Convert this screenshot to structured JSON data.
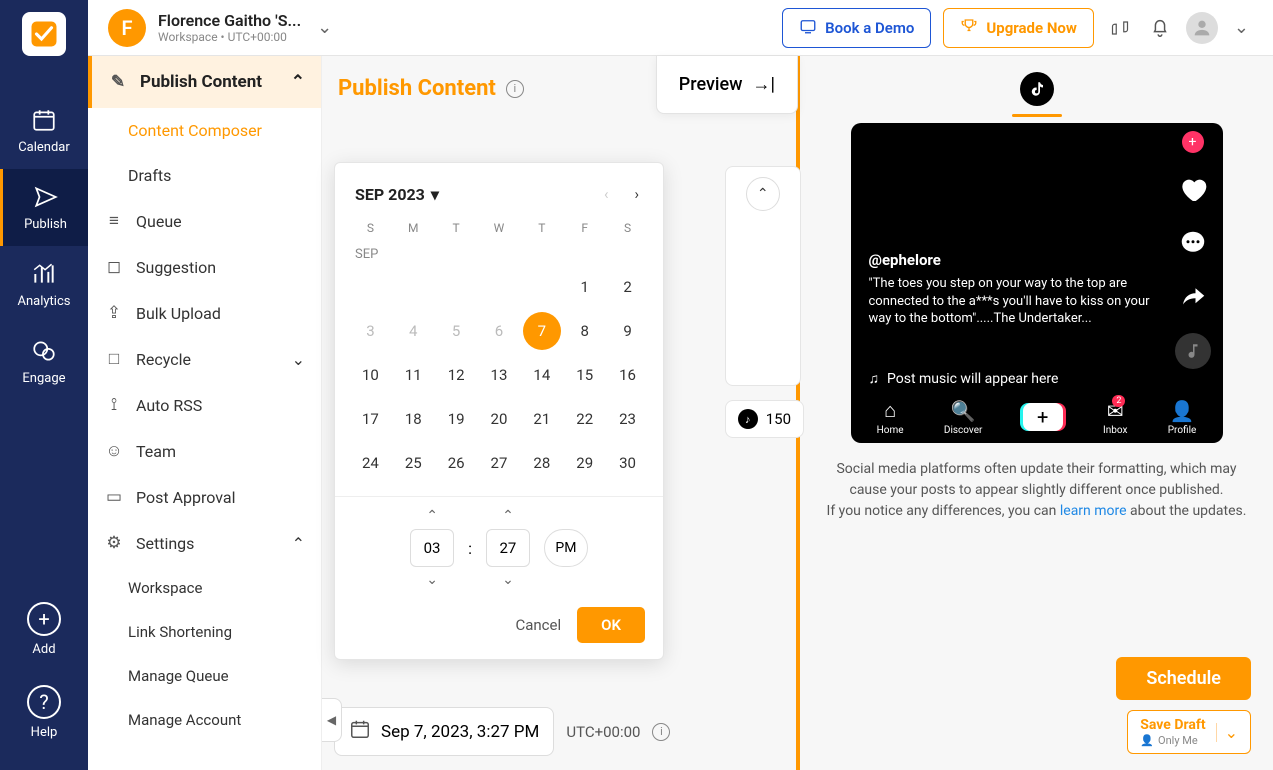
{
  "topbar": {
    "avatar_letter": "F",
    "workspace_name": "Florence Gaitho 'S...",
    "workspace_sub": "Workspace • UTC+00:00",
    "book_demo": "Book a Demo",
    "upgrade": "Upgrade Now"
  },
  "rail": {
    "calendar": "Calendar",
    "publish": "Publish",
    "analytics": "Analytics",
    "engage": "Engage",
    "add": "Add",
    "help": "Help"
  },
  "sidepanel": {
    "header": "Publish Content",
    "items": {
      "composer": "Content Composer",
      "drafts": "Drafts",
      "queue": "Queue",
      "suggestion": "Suggestion",
      "bulk": "Bulk Upload",
      "recycle": "Recycle",
      "autorss": "Auto RSS",
      "team": "Team",
      "approval": "Post Approval",
      "settings": "Settings"
    },
    "settings_sub": {
      "workspace": "Workspace",
      "link": "Link Shortening",
      "manage_queue": "Manage Queue",
      "manage_account": "Manage Account"
    }
  },
  "compose": {
    "title": "Publish Content",
    "preview_tab": "Preview",
    "char_count": "150",
    "datetime_display": "Sep 7, 2023, 3:27 PM",
    "timezone": "UTC+00:00"
  },
  "calendar": {
    "month_label": "SEP 2023",
    "sublabel": "SEP",
    "weekdays": [
      "S",
      "M",
      "T",
      "W",
      "T",
      "F",
      "S"
    ],
    "rows": [
      [
        "",
        "",
        "",
        "",
        "",
        "1",
        "2"
      ],
      [
        "3",
        "4",
        "5",
        "6",
        "7",
        "8",
        "9"
      ],
      [
        "10",
        "11",
        "12",
        "13",
        "14",
        "15",
        "16"
      ],
      [
        "17",
        "18",
        "19",
        "20",
        "21",
        "22",
        "23"
      ],
      [
        "24",
        "25",
        "26",
        "27",
        "28",
        "29",
        "30"
      ]
    ],
    "selected": "7",
    "hour": "03",
    "minute": "27",
    "ampm": "PM",
    "cancel": "Cancel",
    "ok": "OK"
  },
  "preview": {
    "handle": "@ephelore",
    "caption": "\"The toes you step on your way to the top are connected to the a***s you'll have to kiss on your way to the bottom\".....The Undertaker...",
    "music": "Post music will appear here",
    "nav": {
      "home": "Home",
      "discover": "Discover",
      "inbox": "Inbox",
      "profile": "Profile",
      "badge": "2"
    },
    "notice_1": "Social media platforms often update their formatting, which may cause your posts to appear slightly different once published.",
    "notice_2a": "If you notice any differences, you can ",
    "notice_link": "learn more",
    "notice_2b": " about the updates."
  },
  "actions": {
    "schedule": "Schedule",
    "save_draft": "Save Draft",
    "only_me": "Only Me"
  }
}
